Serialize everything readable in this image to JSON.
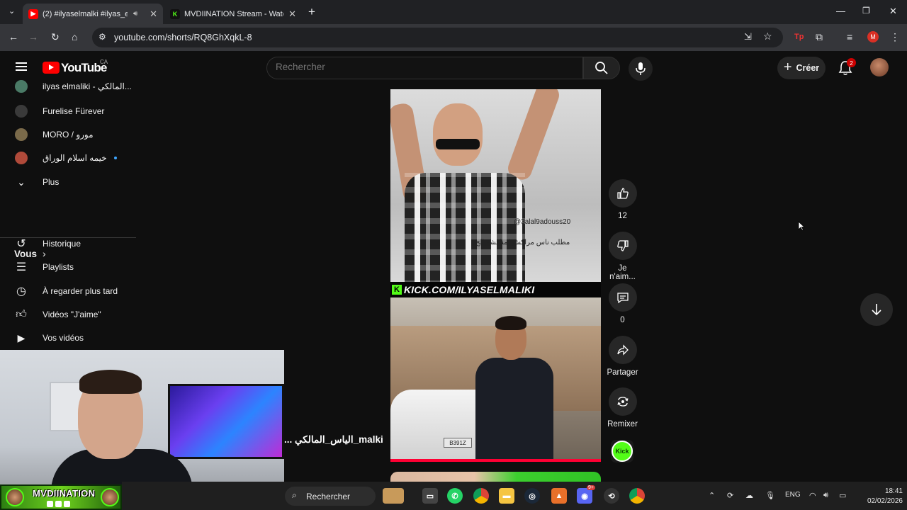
{
  "browser": {
    "tabs": [
      {
        "label": "(2) #ilyaselmalki #ilyas_elm",
        "active": true
      },
      {
        "label": "MVDIINATION Stream - Watch",
        "active": false
      }
    ],
    "url": "youtube.com/shorts/RQ8GhXqkL-8",
    "profile_initial": "M"
  },
  "youtube": {
    "logo_word": "YouTube",
    "country": "CA",
    "search_placeholder": "Rechercher",
    "create_label": "Créer",
    "notification_count": "2"
  },
  "sidebar": {
    "subscriptions": [
      {
        "label": "ilyas elmaliki - المالكي...",
        "color": "#4a7a66",
        "live": false
      },
      {
        "label": "Furelise Fürever",
        "color": "#3a3a3a",
        "live": false
      },
      {
        "label": "MORO / مورو",
        "color": "#7a6a4a",
        "live": false
      },
      {
        "label": "خيمه اسلام الوراق",
        "color": "#b04a3a",
        "live": true
      }
    ],
    "more_label": "Plus",
    "you_section_title": "Vous",
    "you_items": [
      {
        "label": "Historique",
        "icon": "history-icon"
      },
      {
        "label": "Playlists",
        "icon": "playlists-icon"
      },
      {
        "label": "À regarder plus tard",
        "icon": "watch-later-icon"
      },
      {
        "label": "Vidéos \"J'aime\"",
        "icon": "liked-videos-icon"
      },
      {
        "label": "Vos vidéos",
        "icon": "your-videos-icon"
      }
    ]
  },
  "short": {
    "handle_watermark": "@3alal9adouss20",
    "arabic_caption": "مطلب ناس مراكش لمناقشة الح",
    "kick_banner": "KICK.COM/ILYASELMALIKI",
    "license_plate": "B391Z",
    "channel_overlay": "... الياس_المالكي_malki",
    "progress_percent": 100
  },
  "actions": {
    "like_count": "12",
    "dislike_label": "Je n'aim...",
    "comment_count": "0",
    "share_label": "Partager",
    "remix_label": "Remixer",
    "channel_avatar_text": "Kick"
  },
  "overlay": {
    "streamer_name": "MVDIINATION"
  },
  "taskbar": {
    "search_label": "Rechercher",
    "language": "ENG",
    "time": "18:41",
    "date": "02/02/2026",
    "discord_badge": "9+"
  }
}
